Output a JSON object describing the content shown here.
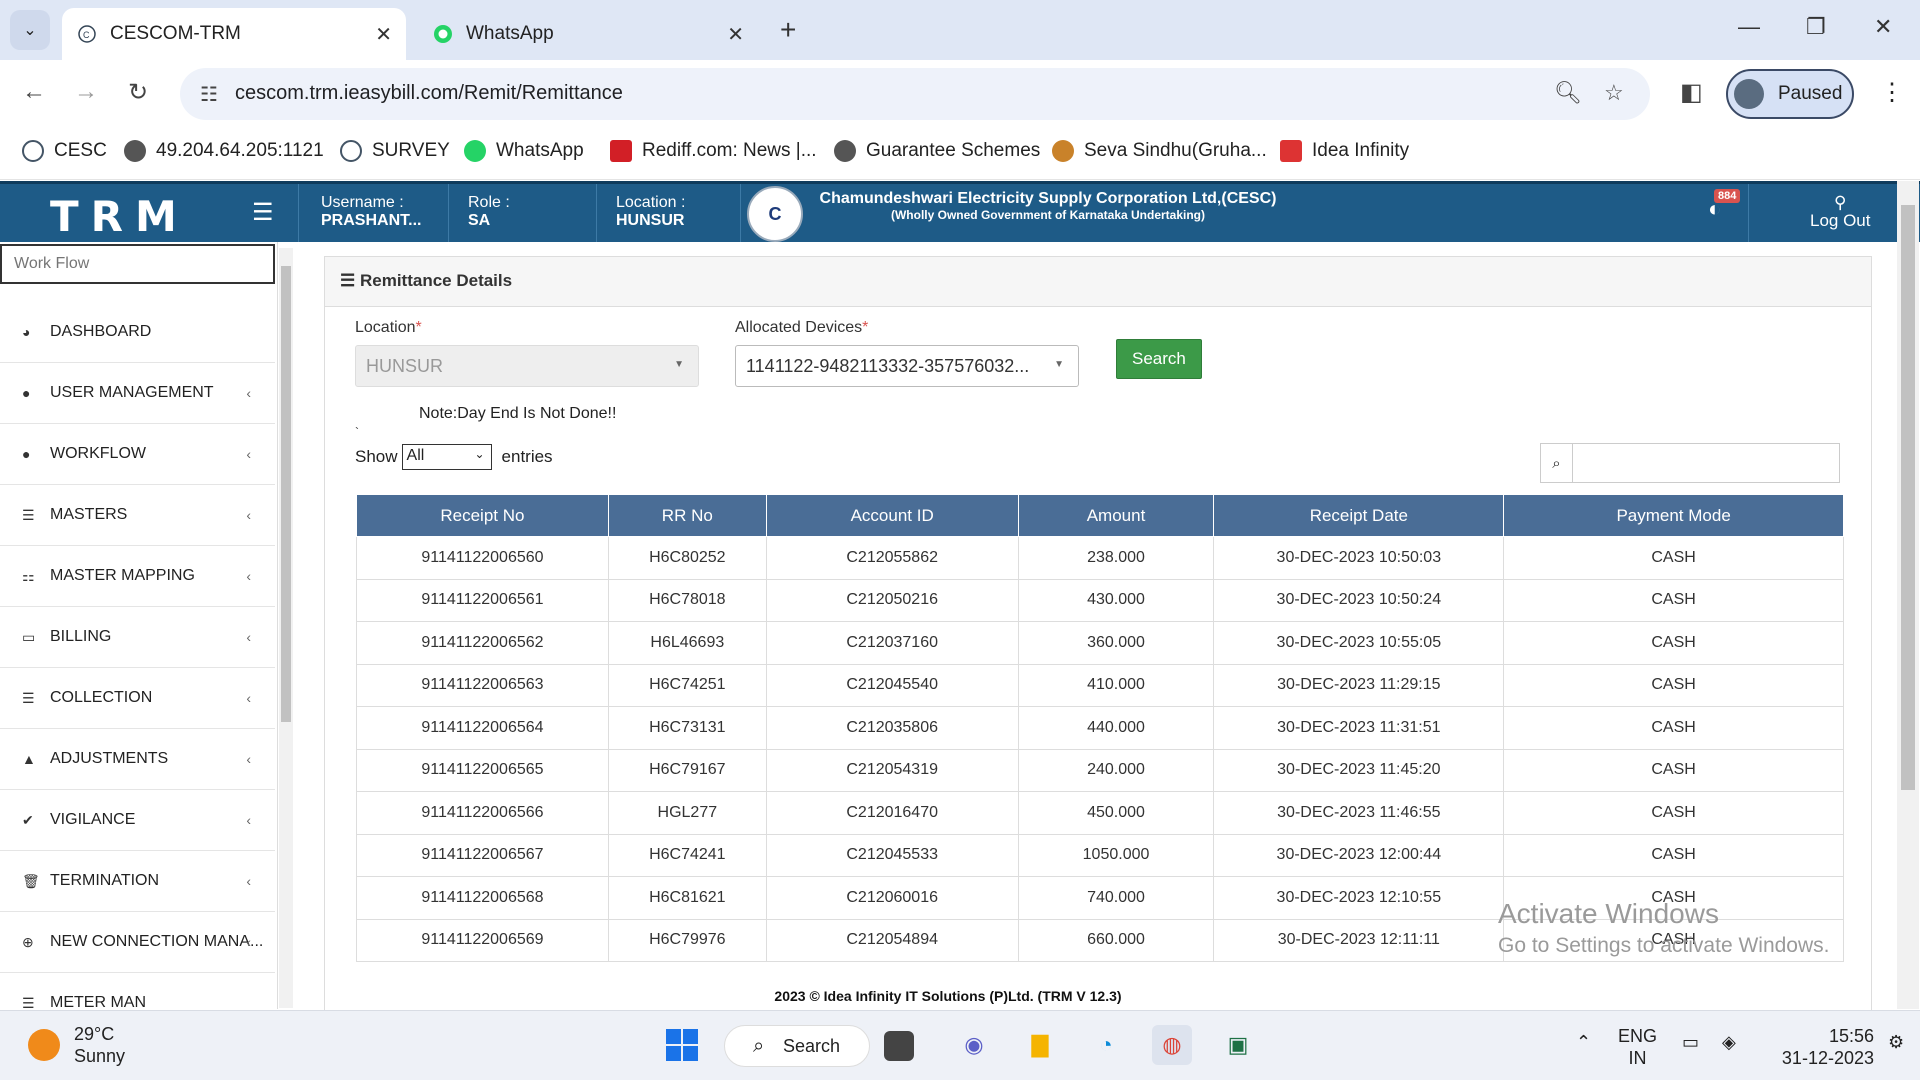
{
  "browser": {
    "tabs": [
      {
        "title": "CESCOM-TRM",
        "active": true
      },
      {
        "title": "WhatsApp",
        "active": false
      }
    ],
    "url": "cescom.trm.ieasybill.com/Remit/Remittance",
    "profile_label": "Paused",
    "bookmarks": [
      "CESC",
      "49.204.64.205:1121",
      "SURVEY",
      "WhatsApp",
      "Rediff.com: News |...",
      "Guarantee Schemes",
      "Seva Sindhu(Gruha...",
      "Idea Infinity"
    ]
  },
  "header": {
    "brand": "TRM",
    "username_label": "Username :",
    "username": "PRASHANT...",
    "role_label": "Role :",
    "role": "SA",
    "location_label": "Location :",
    "location": "HUNSUR",
    "corp_name": "Chamundeshwari Electricity Supply Corporation Ltd,(CESC)",
    "corp_sub": "(Wholly Owned Government of Karnataka Undertaking)",
    "notification_count": "884",
    "logout_label": "Log Out"
  },
  "sidebar": {
    "workflow_placeholder": "Work Flow",
    "items": [
      {
        "label": "DASHBOARD",
        "icon": "dashboard-icon",
        "has_chevron": false
      },
      {
        "label": "USER MANAGEMENT",
        "icon": "user-icon",
        "has_chevron": true
      },
      {
        "label": "WORKFLOW",
        "icon": "user-icon",
        "has_chevron": true
      },
      {
        "label": "MASTERS",
        "icon": "list-icon",
        "has_chevron": true
      },
      {
        "label": "MASTER MAPPING",
        "icon": "sitemap-icon",
        "has_chevron": true
      },
      {
        "label": "BILLING",
        "icon": "monitor-icon",
        "has_chevron": true
      },
      {
        "label": "COLLECTION",
        "icon": "list-icon",
        "has_chevron": true
      },
      {
        "label": "ADJUSTMENTS",
        "icon": "adjust-icon",
        "has_chevron": true
      },
      {
        "label": "VIGILANCE",
        "icon": "vigilance-icon",
        "has_chevron": true
      },
      {
        "label": "TERMINATION",
        "icon": "trash-icon",
        "has_chevron": true
      },
      {
        "label": "NEW CONNECTION MANA...",
        "icon": "plus-circle-icon",
        "has_chevron": true
      },
      {
        "label": "METER MAN",
        "icon": "list-icon",
        "has_chevron": false
      }
    ]
  },
  "remittance": {
    "panel_title": "Remittance Details",
    "location_label": "Location",
    "location_value": "HUNSUR",
    "devices_label": "Allocated Devices",
    "devices_value": "1141122-9482113332-357576032...",
    "search_button": "Search",
    "note": "Note:Day End Is Not Done!!",
    "tick": "`",
    "show_label": "Show",
    "show_value": "All",
    "entries_label": "entries",
    "columns": [
      "Receipt No",
      "RR No",
      "Account ID",
      "Amount",
      "Receipt Date",
      "Payment Mode"
    ],
    "rows": [
      [
        "91141122006560",
        "H6C80252",
        "C212055862",
        "238.000",
        "30-DEC-2023 10:50:03",
        "CASH"
      ],
      [
        "91141122006561",
        "H6C78018",
        "C212050216",
        "430.000",
        "30-DEC-2023 10:50:24",
        "CASH"
      ],
      [
        "91141122006562",
        "H6L46693",
        "C212037160",
        "360.000",
        "30-DEC-2023 10:55:05",
        "CASH"
      ],
      [
        "91141122006563",
        "H6C74251",
        "C212045540",
        "410.000",
        "30-DEC-2023 11:29:15",
        "CASH"
      ],
      [
        "91141122006564",
        "H6C73131",
        "C212035806",
        "440.000",
        "30-DEC-2023 11:31:51",
        "CASH"
      ],
      [
        "91141122006565",
        "H6C79167",
        "C212054319",
        "240.000",
        "30-DEC-2023 11:45:20",
        "CASH"
      ],
      [
        "91141122006566",
        "HGL277",
        "C212016470",
        "450.000",
        "30-DEC-2023 11:46:55",
        "CASH"
      ],
      [
        "91141122006567",
        "H6C74241",
        "C212045533",
        "1050.000",
        "30-DEC-2023 12:00:44",
        "CASH"
      ],
      [
        "91141122006568",
        "H6C81621",
        "C212060016",
        "740.000",
        "30-DEC-2023 12:10:55",
        "CASH"
      ],
      [
        "91141122006569",
        "H6C79976",
        "C212054894",
        "660.000",
        "30-DEC-2023 12:11:11",
        "CASH"
      ]
    ]
  },
  "footer": "2023 © Idea Infinity IT Solutions (P)Ltd. (TRM V 12.3)",
  "watermark": {
    "title": "Activate Windows",
    "sub": "Go to Settings to activate Windows."
  },
  "taskbar": {
    "temperature": "29°C",
    "weather": "Sunny",
    "search_label": "Search",
    "lang": "ENG",
    "region": "IN",
    "time": "15:56",
    "date": "31-12-2023"
  },
  "colors": {
    "header_bg": "#1e5b87",
    "table_header": "#4a6d96",
    "search_button": "#3c9a48",
    "badge": "#d9534f"
  }
}
